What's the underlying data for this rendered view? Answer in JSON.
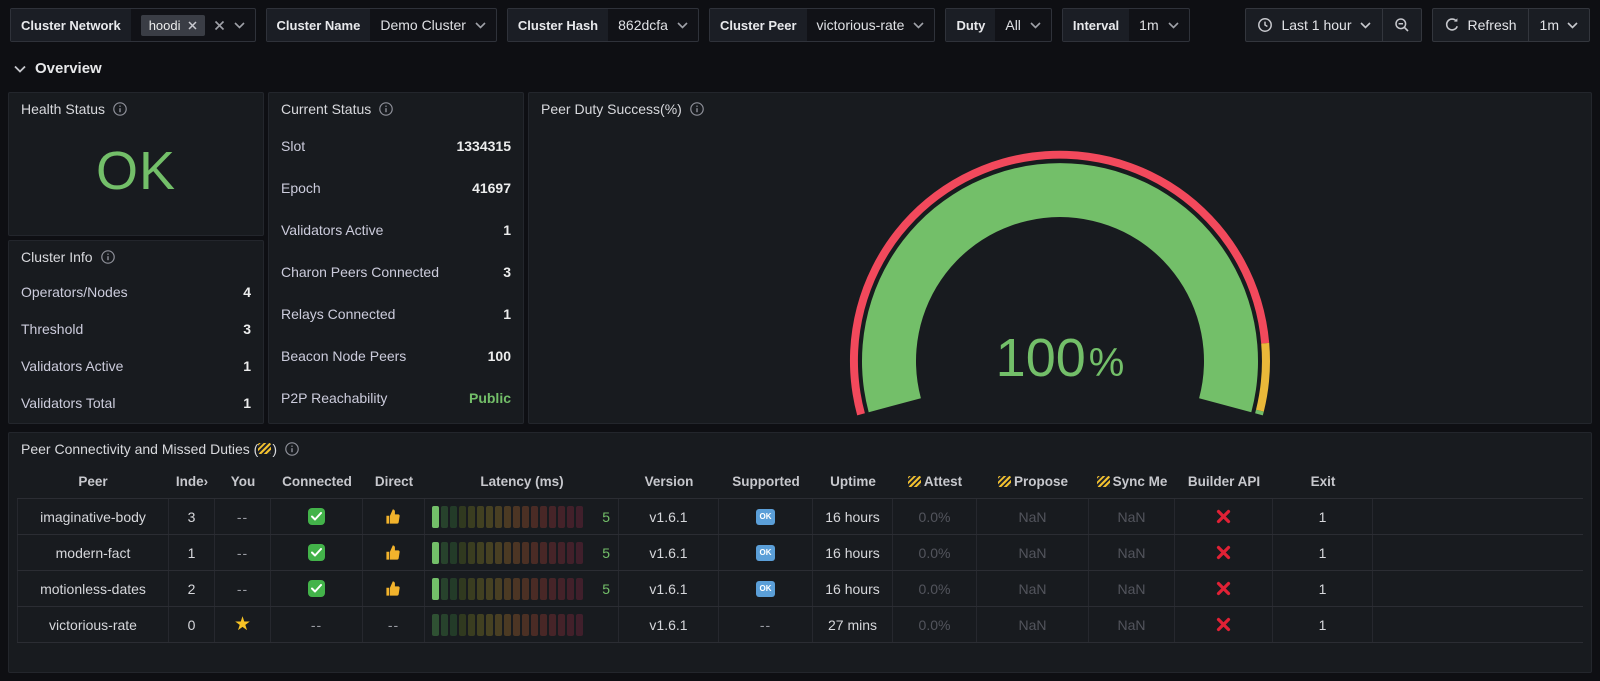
{
  "toolbar": {
    "filters": [
      {
        "label": "Cluster Network",
        "value": "hoodi"
      },
      {
        "label": "Cluster Name",
        "value": "Demo Cluster"
      },
      {
        "label": "Cluster Hash",
        "value": "862dcfa"
      },
      {
        "label": "Cluster Peer",
        "value": "victorious-rate"
      },
      {
        "label": "Duty",
        "value": "All"
      },
      {
        "label": "Interval",
        "value": "1m"
      }
    ],
    "time_range": "Last 1 hour",
    "refresh_label": "Refresh",
    "refresh_interval": "1m"
  },
  "section": {
    "title": "Overview"
  },
  "health": {
    "title": "Health Status",
    "value": "OK",
    "value_color": "#73BF69"
  },
  "cluster_info": {
    "title": "Cluster Info",
    "rows": [
      {
        "label": "Operators/Nodes",
        "value": "4"
      },
      {
        "label": "Threshold",
        "value": "3"
      },
      {
        "label": "Validators Active",
        "value": "1"
      },
      {
        "label": "Validators Total",
        "value": "1"
      }
    ]
  },
  "current_status": {
    "title": "Current Status",
    "rows": [
      {
        "label": "Slot",
        "value": "1334315"
      },
      {
        "label": "Epoch",
        "value": "41697"
      },
      {
        "label": "Validators Active",
        "value": "1"
      },
      {
        "label": "Charon Peers Connected",
        "value": "3"
      },
      {
        "label": "Relays Connected",
        "value": "1"
      },
      {
        "label": "Beacon Node Peers",
        "value": "100"
      },
      {
        "label": "P2P Reachability",
        "value": "Public",
        "value_color": "#73BF69"
      }
    ]
  },
  "gauge": {
    "title": "Peer Duty Success(%)",
    "value": "100",
    "unit": "%",
    "value_fraction": 1,
    "fill_color": "#73BF69",
    "band": [
      {
        "color": "#F2495C",
        "to": 0.905
      },
      {
        "color": "#EAB839",
        "to": 0.995
      },
      {
        "color": "#73BF69",
        "to": 1
      }
    ]
  },
  "peer_table": {
    "title_prefix": "Peer Connectivity and Missed Duties (",
    "title_suffix": ")",
    "columns": [
      {
        "key": "peer",
        "label": "Peer"
      },
      {
        "key": "index",
        "label": "Inde›"
      },
      {
        "key": "you",
        "label": "You"
      },
      {
        "key": "connected",
        "label": "Connected"
      },
      {
        "key": "direct",
        "label": "Direct"
      },
      {
        "key": "latency",
        "label": "Latency (ms)"
      },
      {
        "key": "version",
        "label": "Version"
      },
      {
        "key": "supported",
        "label": "Supported"
      },
      {
        "key": "uptime",
        "label": "Uptime"
      },
      {
        "key": "attest",
        "label": "Attest",
        "hazard": true
      },
      {
        "key": "propose",
        "label": "Propose",
        "hazard": true
      },
      {
        "key": "sync_me",
        "label": "Sync Me",
        "hazard": true
      },
      {
        "key": "builder_api",
        "label": "Builder API"
      },
      {
        "key": "exit",
        "label": "Exit"
      }
    ],
    "icons": {
      "supported_ok_text": "OK",
      "star_glyph": "★"
    },
    "latency_lit_color": "#73BF69",
    "latency_palette": [
      "#2f5133",
      "#27422c",
      "#233b28",
      "#30391f",
      "#3a3d20",
      "#414021",
      "#464122",
      "#493f23",
      "#4b3a23",
      "#4c3524",
      "#4b3024",
      "#4a2b25",
      "#482726",
      "#462428",
      "#442229",
      "#42202a",
      "#401f2b"
    ],
    "rows": [
      {
        "peer": "imaginative-body",
        "index": "3",
        "you": "--",
        "connected": "check",
        "direct": "thumb",
        "latency_lit": true,
        "latency_value": "5",
        "version": "v1.6.1",
        "supported": "ok",
        "uptime": "16 hours",
        "attest": "0.0%",
        "propose": "NaN",
        "sync_me": "NaN",
        "builder_api": "x",
        "exit": "1"
      },
      {
        "peer": "modern-fact",
        "index": "1",
        "you": "--",
        "connected": "check",
        "direct": "thumb",
        "latency_lit": true,
        "latency_value": "5",
        "version": "v1.6.1",
        "supported": "ok",
        "uptime": "16 hours",
        "attest": "0.0%",
        "propose": "NaN",
        "sync_me": "NaN",
        "builder_api": "x",
        "exit": "1"
      },
      {
        "peer": "motionless-dates",
        "index": "2",
        "you": "--",
        "connected": "check",
        "direct": "thumb",
        "latency_lit": true,
        "latency_value": "5",
        "version": "v1.6.1",
        "supported": "ok",
        "uptime": "16 hours",
        "attest": "0.0%",
        "propose": "NaN",
        "sync_me": "NaN",
        "builder_api": "x",
        "exit": "1"
      },
      {
        "peer": "victorious-rate",
        "index": "0",
        "you": "star",
        "connected": "--",
        "direct": "--",
        "latency_lit": false,
        "latency_value": "",
        "version": "v1.6.1",
        "supported": "--",
        "uptime": "27 mins",
        "attest": "0.0%",
        "propose": "NaN",
        "sync_me": "NaN",
        "builder_api": "x",
        "exit": "1"
      }
    ]
  }
}
